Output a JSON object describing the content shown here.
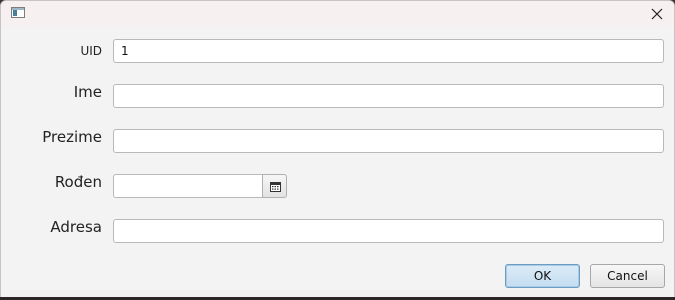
{
  "window": {
    "close_symbol": "✕"
  },
  "form": {
    "uid": {
      "label": "UID",
      "value": "1"
    },
    "ime": {
      "label": "Ime",
      "value": ""
    },
    "prezime": {
      "label": "Prezime",
      "value": ""
    },
    "roden": {
      "label": "Rođen",
      "value": "",
      "button_icon": "calendar-icon"
    },
    "adresa": {
      "label": "Adresa",
      "value": ""
    }
  },
  "buttons": {
    "ok": "OK",
    "cancel": "Cancel"
  },
  "colors": {
    "window_bg": "#f3f3f3",
    "titlebar_bg": "#f7f0f1",
    "ok_button_border": "#6d9cc2",
    "ok_button_fill": "#c4ddf0"
  }
}
